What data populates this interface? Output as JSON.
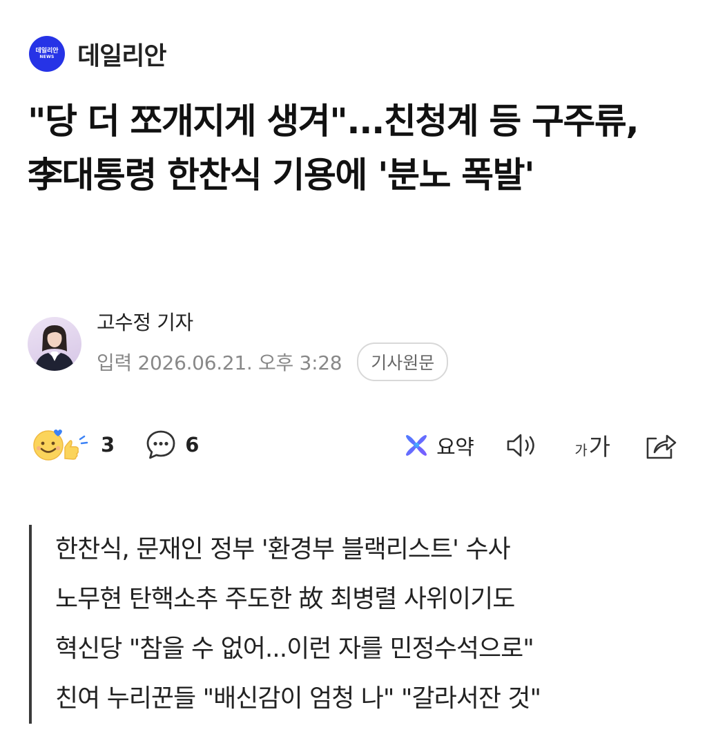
{
  "publisher": {
    "logo_line1": "데일리안",
    "logo_line2": "NEWS",
    "name": "데일리안",
    "brand_color": "#2633e6"
  },
  "article": {
    "headline": "\"당 더 쪼개지게 생겨\"...친청계 등 구주류, 李대통령 한찬식 기용에 '분노 폭발'",
    "reporter": "고수정 기자",
    "date": "입력 2026.06.21. 오후 3:28",
    "original_button": "기사원문"
  },
  "actions": {
    "reaction_icon": "smile-thumbsup-emoji-icon",
    "reaction_count": "3",
    "comment_icon": "comment-bubble-icon",
    "comment_count": "6",
    "summary_icon": "ai-summary-icon",
    "summary_label": "요약",
    "speaker_icon": "speaker-icon",
    "font_size_small": "가",
    "font_size_big": "가",
    "share_icon": "share-icon"
  },
  "summary": {
    "highlight_color": "#fde98a",
    "line1_highlight": "한찬식",
    "line1_rest": ", 문재인 정부 '환경부 블랙리스트' 수사",
    "line2": "노무현 탄핵소추 주도한 故 최병렬 사위이기도",
    "line3": "혁신당 \"참을 수 없어...이런 자를 민정수석으로\"",
    "line4": "친여 누리꾼들 \"배신감이 엄청 나\" \"갈라서잔 것\""
  }
}
